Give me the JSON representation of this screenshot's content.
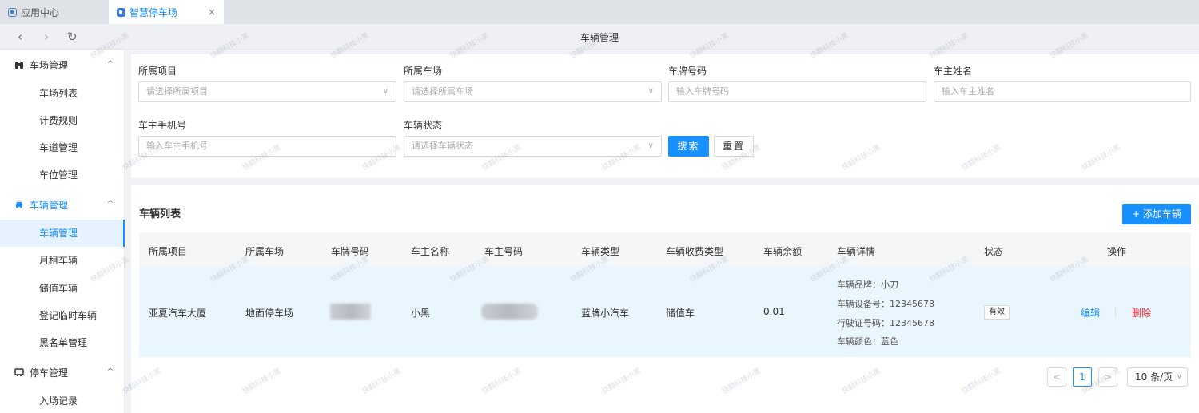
{
  "tabs": [
    {
      "label": "应用中心",
      "active": false
    },
    {
      "label": "智慧停车场",
      "active": true,
      "close": "×"
    }
  ],
  "nav": {
    "back": "‹",
    "forward": "›",
    "reload": "↻",
    "title": "车辆管理"
  },
  "sidebar": {
    "groups": [
      {
        "label": "车场管理",
        "icon": "binoculars-icon",
        "arrow": "^",
        "items": [
          "车场列表",
          "计费规则",
          "车道管理",
          "车位管理"
        ]
      },
      {
        "label": "车辆管理",
        "icon": "car-icon",
        "arrow": "^",
        "active": true,
        "items": [
          "车辆管理",
          "月租车辆",
          "储值车辆",
          "登记临时车辆",
          "黑名单管理"
        ]
      },
      {
        "label": "停车管理",
        "icon": "parking-icon",
        "arrow": "^",
        "items": [
          "入场记录"
        ]
      }
    ]
  },
  "filter": {
    "project": {
      "label": "所属项目",
      "placeholder": "请选择所属项目"
    },
    "lot": {
      "label": "所属车场",
      "placeholder": "请选择所属车场"
    },
    "plate": {
      "label": "车牌号码",
      "placeholder": "输入车牌号码"
    },
    "owner_name": {
      "label": "车主姓名",
      "placeholder": "输入车主姓名"
    },
    "owner_phone": {
      "label": "车主手机号",
      "placeholder": "输入车主手机号"
    },
    "status": {
      "label": "车辆状态",
      "placeholder": "请选择车辆状态"
    },
    "search_label": "搜索",
    "reset_label": "重置"
  },
  "list": {
    "title": "车辆列表",
    "add_label": "+ 添加车辆",
    "columns": [
      "所属项目",
      "所属车场",
      "车牌号码",
      "车主名称",
      "车主号码",
      "车辆类型",
      "车辆收费类型",
      "车辆余额",
      "车辆详情",
      "状态",
      "操作"
    ],
    "rows": [
      {
        "project": "亚夏汽车大厦",
        "lot": "地面停车场",
        "plate": "",
        "owner_name": "小黑",
        "owner_phone": "",
        "vehicle_type": "蓝牌小汽车",
        "fee_type": "储值车",
        "balance": "0.01",
        "details": [
          "车辆品牌：小刀",
          "车辆设备号：12345678",
          "行驶证号码：12345678",
          "车辆颜色：蓝色"
        ],
        "status": "有效",
        "edit_label": "编辑",
        "delete_label": "删除"
      }
    ]
  },
  "pagination": {
    "prev": "<",
    "current": "1",
    "next": ">",
    "page_size": "10 条/页"
  },
  "watermark": "快翻科技小黑",
  "colors": {
    "primary": "#1890ff",
    "danger": "#f5222d",
    "row_highlight": "#eaf6fd"
  }
}
